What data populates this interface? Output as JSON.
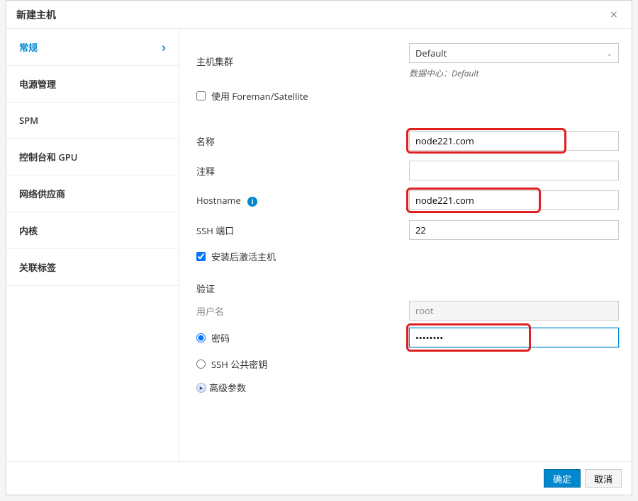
{
  "dialog": {
    "title": "新建主机",
    "ok_label": "确定",
    "cancel_label": "取消"
  },
  "sidebar": {
    "items": [
      {
        "label": "常规",
        "active": true
      },
      {
        "label": "电源管理"
      },
      {
        "label": "SPM"
      },
      {
        "label": "控制台和 GPU"
      },
      {
        "label": "网络供应商"
      },
      {
        "label": "内核"
      },
      {
        "label": "关联标签"
      }
    ]
  },
  "form": {
    "cluster_label": "主机集群",
    "cluster_value": "Default",
    "datacenter_hint": "数据中心：Default",
    "use_foreman_label": "使用 Foreman/Satellite",
    "use_foreman_checked": false,
    "name_label": "名称",
    "name_value": "node221.com",
    "comment_label": "注释",
    "comment_value": "",
    "hostname_label": "Hostname",
    "hostname_value": "node221.com",
    "sshport_label": "SSH 端口",
    "sshport_value": "22",
    "activate_label": "安装后激活主机",
    "activate_checked": true,
    "auth_section_label": "验证",
    "username_label": "用户名",
    "username_value": "root",
    "password_radio_label": "密码",
    "password_value": "••••••••",
    "sshkey_radio_label": "SSH 公共密钥",
    "advanced_label": "高级参数"
  }
}
